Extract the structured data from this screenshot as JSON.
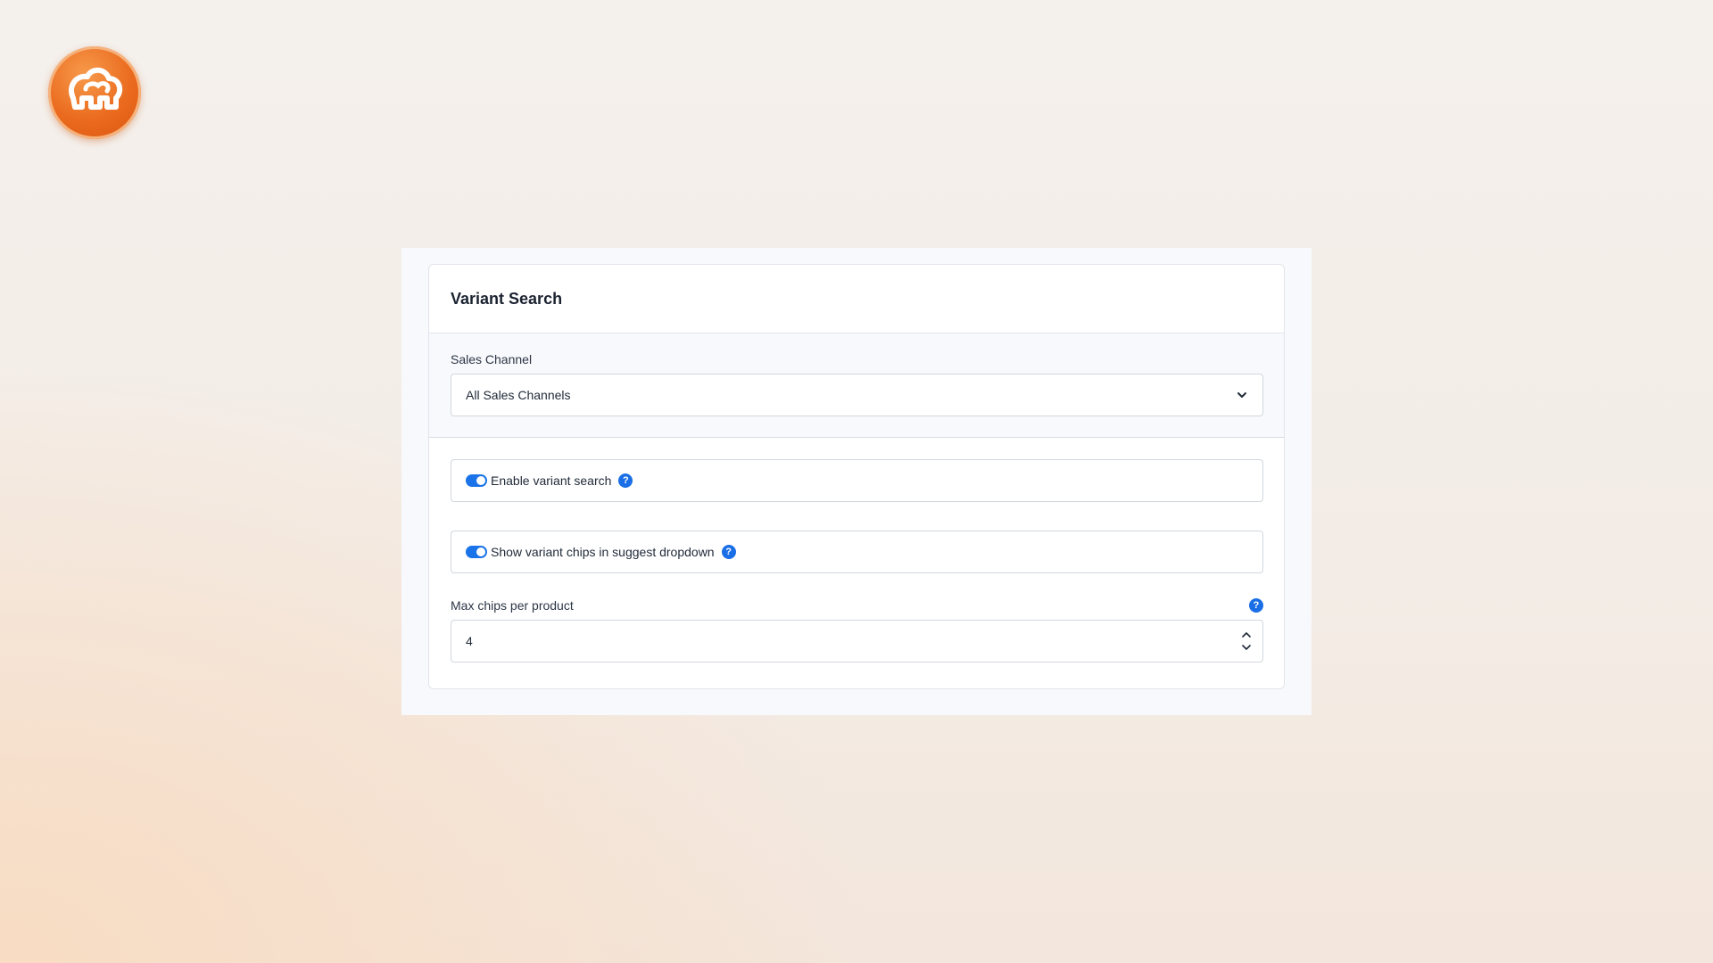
{
  "logo": {
    "icon": "shopware-logo-icon",
    "brand_color": "#ea6a1e"
  },
  "panel": {
    "title": "Variant Search",
    "sales_channel": {
      "label": "Sales Channel",
      "value": "All Sales Channels",
      "icon": "chevron-down-icon"
    },
    "toggles": [
      {
        "label": "Enable variant search",
        "enabled": true,
        "help_icon": "help-icon"
      },
      {
        "label": "Show variant chips in suggest dropdown",
        "enabled": true,
        "help_icon": "help-icon"
      }
    ],
    "max_chips": {
      "label": "Max chips per product",
      "value": "4",
      "help_icon": "help-icon"
    }
  },
  "help_glyph": "?",
  "colors": {
    "accent": "#1a73e8",
    "help": "#1a6fe6"
  }
}
